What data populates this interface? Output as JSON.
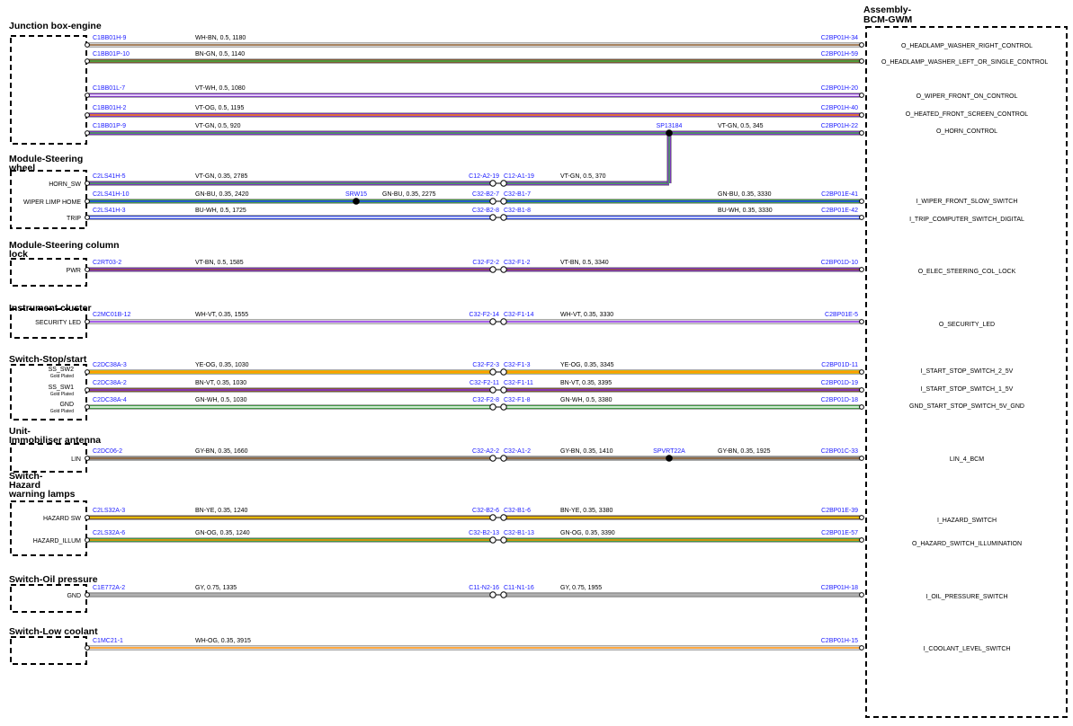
{
  "target": {
    "title_line1": "Assembly-",
    "title_line2": "BCM-GWM",
    "signals": [
      "O_HEADLAMP_WASHER_RIGHT_CONTROL",
      "O_HEADLAMP_WASHER_LEFT_OR_SINGLE_CONTROL",
      "O_WIPER_FRONT_ON_CONTROL",
      "O_HEATED_FRONT_SCREEN_CONTROL",
      "O_HORN_CONTROL",
      "I_WIPER_FRONT_SLOW_SWITCH",
      "I_TRIP_COMPUTER_SWITCH_DIGITAL",
      "O_ELEC_STEERING_COL_LOCK",
      "O_SECURITY_LED",
      "I_START_STOP_SWITCH_2_5V",
      "I_START_STOP_SWITCH_1_5V",
      "GND_START_STOP_SWITCH_5V_GND",
      "LIN_4_BCM",
      "I_HAZARD_SWITCH",
      "O_HAZARD_SWITCH_ILLUMINATION",
      "I_OIL_PRESSURE_SWITCH",
      "I_COOLANT_LEVEL_SWITCH"
    ]
  },
  "modules": [
    {
      "title": [
        "Junction box-engine"
      ],
      "pins": []
    },
    {
      "title": [
        "Module-Steering",
        "wheel"
      ],
      "pins": [
        {
          "label": "HORN_SW"
        },
        {
          "label": "WIPER LIMP HOME"
        },
        {
          "label": "TRIP"
        }
      ]
    },
    {
      "title": [
        "Module-Steering column",
        "lock"
      ],
      "pins": [
        {
          "label": "PWR"
        }
      ]
    },
    {
      "title": [
        "Instrument cluster"
      ],
      "pins": [
        {
          "label": "SECURITY LED"
        }
      ]
    },
    {
      "title": [
        "Switch-Stop/start"
      ],
      "pins": [
        {
          "label": "SS_SW2",
          "sub": "Gold Plated"
        },
        {
          "label": "SS_SW1",
          "sub": "Gold Plated"
        },
        {
          "label": "GND",
          "sub": "Gold Plated"
        }
      ]
    },
    {
      "title": [
        "Unit-",
        "Immobiliser antenna"
      ],
      "pins": [
        {
          "label": "LIN"
        }
      ]
    },
    {
      "title": [
        "Switch-",
        "Hazard",
        "warning lamps"
      ],
      "pins": [
        {
          "label": "HAZARD SW"
        },
        {
          "label": "HAZARD_ILLUM"
        }
      ]
    },
    {
      "title": [
        "Switch-Oil pressure"
      ],
      "pins": [
        {
          "label": "GND"
        }
      ]
    },
    {
      "title": [
        "Switch-Low coolant"
      ],
      "pins": []
    }
  ],
  "wires": [
    {
      "from": "C1BB01H-9",
      "spec": "WH-BN, 0.5, 1180",
      "to": "C2BP01H-34",
      "colors": [
        "#ffffff",
        "#8b5a2b"
      ]
    },
    {
      "from": "C1BB01P-10",
      "spec": "BN-GN, 0.5, 1140",
      "to": "C2BP01H-59",
      "colors": [
        "#8b5a2b",
        "#3cb043"
      ]
    },
    {
      "from": "C1BB01L-7",
      "spec": "VT-WH, 0.5, 1080",
      "to": "C2BP01H-20",
      "colors": [
        "#8a2be2",
        "#ffffff"
      ]
    },
    {
      "from": "C1BB01H-2",
      "spec": "VT-OG, 0.5, 1195",
      "to": "C2BP01H-40",
      "colors": [
        "#8a2be2",
        "#ff8c00"
      ]
    },
    {
      "from": "C1BB01P-9",
      "spec": "VT-GN, 0.5, 920",
      "to": "C2BP01H-22",
      "colors": [
        "#8a2be2",
        "#3cb043"
      ],
      "splice": "SP13184",
      "spec2": "VT-GN, 0.5, 345"
    },
    {
      "from": "C2LS41H-5",
      "spec": "VT-GN, 0.35, 2785",
      "inline": [
        "C12-A2-19",
        "C12-A1-19"
      ],
      "spec2": "VT-GN, 0.5, 370",
      "colors": [
        "#8a2be2",
        "#3cb043"
      ]
    },
    {
      "from": "C2LS41H-10",
      "spec": "GN-BU, 0.35, 2420",
      "splice": "SRW15",
      "spec_mid": "GN-BU, 0.35, 2275",
      "inline": [
        "C32-B2-7",
        "C32-B1-7"
      ],
      "spec2": "GN-BU, 0.35, 3330",
      "to": "C2BP01E-41",
      "colors": [
        "#3cb043",
        "#1e3cff"
      ]
    },
    {
      "from": "C2LS41H-3",
      "spec": "BU-WH, 0.5, 1725",
      "inline": [
        "C32-B2-8",
        "C32-B1-8"
      ],
      "spec2": "BU-WH, 0.35, 3330",
      "to": "C2BP01E-42",
      "colors": [
        "#1e3cff",
        "#ffffff"
      ]
    },
    {
      "from": "C2RT03-2",
      "spec": "VT-BN, 0.5, 1585",
      "inline": [
        "C32-F2-2",
        "C32-F1-2"
      ],
      "spec2": "VT-BN, 0.5, 3340",
      "to": "C2BP01D-10",
      "colors": [
        "#8a2be2",
        "#8b5a2b"
      ]
    },
    {
      "from": "C2MC01B-12",
      "spec": "WH-VT, 0.35, 1555",
      "inline": [
        "C32-F2-14",
        "C32-F1-14"
      ],
      "spec2": "WH-VT, 0.35, 3330",
      "to": "C2BP01E-5",
      "colors": [
        "#ffffff",
        "#8a2be2"
      ]
    },
    {
      "from": "C2DC38A-3",
      "spec": "YE-OG, 0.35, 1030",
      "inline": [
        "C32-F2-3",
        "C32-F1-3"
      ],
      "spec2": "YE-OG, 0.35, 3345",
      "to": "C2BP01D-11",
      "colors": [
        "#ffd700",
        "#ff8c00"
      ]
    },
    {
      "from": "C2DC38A-2",
      "spec": "BN-VT, 0.35, 1030",
      "inline": [
        "C32-F2-11",
        "C32-F1-11"
      ],
      "spec2": "BN-VT, 0.35, 3395",
      "to": "C2BP01D-19",
      "colors": [
        "#8b5a2b",
        "#8a2be2"
      ]
    },
    {
      "from": "C2DC38A-4",
      "spec": "GN-WH, 0.5, 1030",
      "inline": [
        "C32-F2-8",
        "C32-F1-8"
      ],
      "spec2": "GN-WH, 0.5, 3380",
      "to": "C2BP01D-18",
      "colors": [
        "#3cb043",
        "#ffffff"
      ]
    },
    {
      "from": "C2DC06-2",
      "spec": "GY-BN, 0.35, 1660",
      "inline": [
        "C32-A2-2",
        "C32-A1-2"
      ],
      "spec2": "GY-BN, 0.35, 1410",
      "splice": "SPVRT22A",
      "spec3": "GY-BN, 0.35, 1925",
      "to": "C2BP01C-33",
      "colors": [
        "#a0a0a0",
        "#8b5a2b"
      ]
    },
    {
      "from": "C2LS32A-3",
      "spec": "BN-YE, 0.35, 1240",
      "inline": [
        "C32-B2-6",
        "C32-B1-6"
      ],
      "spec2": "BN-YE, 0.35, 3380",
      "to": "C2BP01E-39",
      "colors": [
        "#8b5a2b",
        "#ffd700"
      ]
    },
    {
      "from": "C2LS32A-6",
      "spec": "GN-OG, 0.35, 1240",
      "inline": [
        "C32-B2-13",
        "C32-B1-13"
      ],
      "spec2": "GN-OG, 0.35, 3390",
      "to": "C2BP01E-57",
      "colors": [
        "#3cb043",
        "#ff8c00"
      ]
    },
    {
      "from": "C1E772A-2",
      "spec": "GY, 0.75, 1335",
      "inline": [
        "C11-N2-16",
        "C11-N1-16"
      ],
      "spec2": "GY, 0.75, 1955",
      "to": "C2BP01H-18",
      "colors": [
        "#b0b0b0",
        "#b0b0b0"
      ]
    },
    {
      "from": "C1MC21-1",
      "spec": "WH-OG, 0.35, 3915",
      "to": "C2BP01H-15",
      "colors": [
        "#ffffff",
        "#ff8c00"
      ]
    }
  ]
}
